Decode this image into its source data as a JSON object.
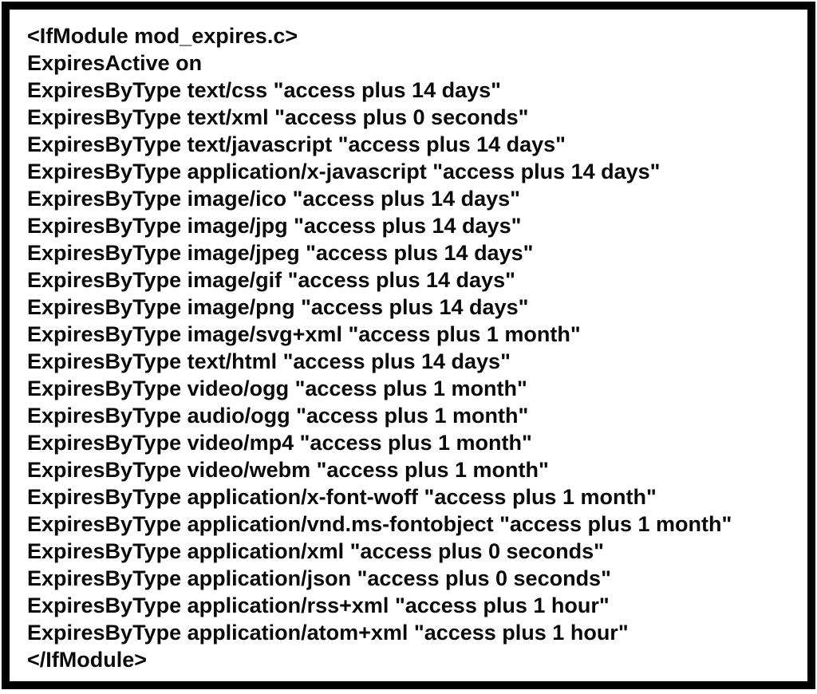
{
  "lines": [
    "<IfModule mod_expires.c>",
    "ExpiresActive on",
    "ExpiresByType text/css \"access plus 14 days\"",
    "ExpiresByType text/xml \"access plus 0 seconds\"",
    "ExpiresByType text/javascript \"access plus 14 days\"",
    "ExpiresByType application/x-javascript \"access plus 14 days\"",
    "ExpiresByType image/ico \"access plus 14 days\"",
    "ExpiresByType image/jpg \"access plus 14 days\"",
    "ExpiresByType image/jpeg \"access plus 14 days\"",
    "ExpiresByType image/gif \"access plus 14 days\"",
    "ExpiresByType image/png \"access plus 14 days\"",
    "ExpiresByType image/svg+xml \"access plus 1 month\"",
    "ExpiresByType text/html \"access plus 14 days\"",
    "ExpiresByType video/ogg \"access plus 1 month\"",
    "ExpiresByType audio/ogg \"access plus 1 month\"",
    "ExpiresByType video/mp4 \"access plus 1 month\"",
    "ExpiresByType video/webm \"access plus 1 month\"",
    "ExpiresByType application/x-font-woff \"access plus 1 month\"",
    "ExpiresByType application/vnd.ms-fontobject \"access plus 1 month\"",
    "ExpiresByType application/xml \"access plus 0 seconds\"",
    "ExpiresByType application/json \"access plus 0 seconds\"",
    "ExpiresByType application/rss+xml \"access plus 1 hour\"",
    "ExpiresByType application/atom+xml \"access plus 1 hour\"",
    "</IfModule>"
  ]
}
